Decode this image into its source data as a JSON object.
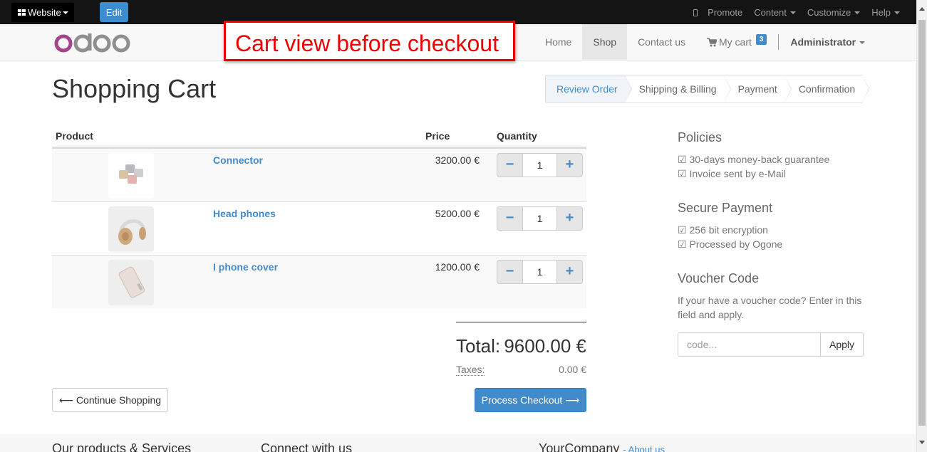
{
  "adminbar": {
    "website_label": "Website",
    "edit_label": "Edit",
    "promote_label": "Promote",
    "content_label": "Content",
    "customize_label": "Customize",
    "help_label": "Help"
  },
  "navbar": {
    "logo_text": "odoo",
    "items": [
      {
        "label": "Home"
      },
      {
        "label": "Shop"
      },
      {
        "label": "Contact us"
      }
    ],
    "cart_label": "My cart",
    "cart_count": "3",
    "user_label": "Administrator"
  },
  "annotation": {
    "text": "Cart view before checkout",
    "color": "#ee0000"
  },
  "page": {
    "title": "Shopping Cart"
  },
  "wizard": {
    "steps": [
      "Review Order",
      "Shipping & Billing",
      "Payment",
      "Confirmation"
    ]
  },
  "cart": {
    "headers": {
      "product": "Product",
      "price": "Price",
      "quantity": "Quantity"
    },
    "rows": [
      {
        "name": "Connector",
        "price": "3200.00 €",
        "qty": "1",
        "image": "connector-image"
      },
      {
        "name": "Head phones",
        "price": "5200.00 €",
        "qty": "1",
        "image": "headphones-image"
      },
      {
        "name": "I phone cover",
        "price": "1200.00 €",
        "qty": "1",
        "image": "phone-cover-image"
      }
    ],
    "total_label": "Total:",
    "total_value": "9600.00 €",
    "taxes_label": "Taxes:",
    "taxes_value": "0.00 €",
    "continue_label": "Continue Shopping",
    "checkout_label": "Process Checkout"
  },
  "sidebar": {
    "policies_title": "Policies",
    "policies": [
      "☑ 30-days money-back guarantee",
      "☑ Invoice sent by e-Mail"
    ],
    "payment_title": "Secure Payment",
    "payment": [
      "☑ 256 bit encryption",
      "☑ Processed by Ogone"
    ],
    "voucher_title": "Voucher Code",
    "voucher_text": "If your have a voucher code? Enter in this field and apply.",
    "voucher_placeholder": "code...",
    "apply_label": "Apply"
  },
  "footer": {
    "col1": "Our products & Services",
    "col2": "Connect with us",
    "col3": "YourCompany",
    "about": "- About us"
  },
  "colors": {
    "accent": "#428bca",
    "annotation": "#ee0000",
    "adminbar": "#141414"
  }
}
